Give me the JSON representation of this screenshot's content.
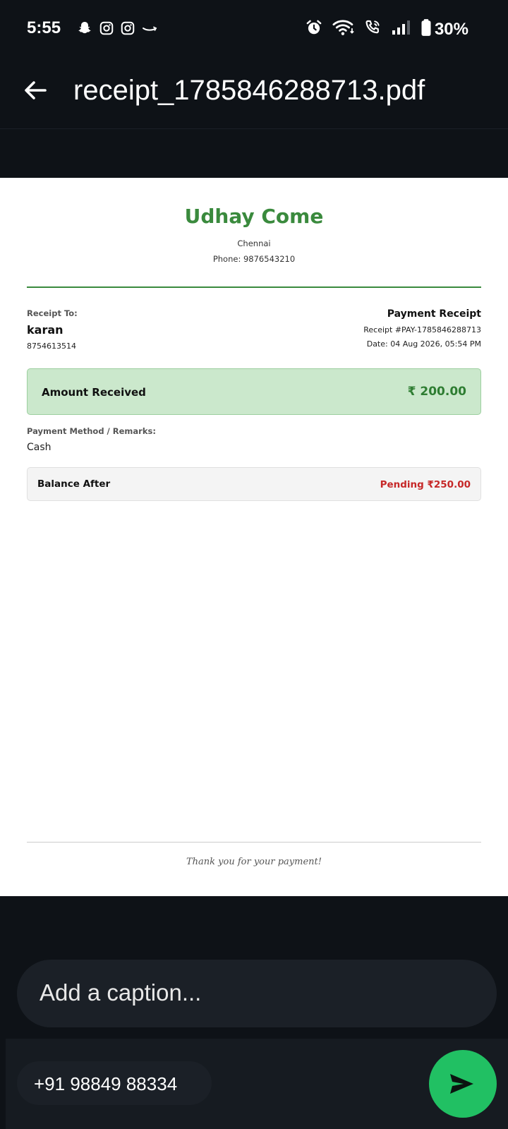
{
  "status_bar": {
    "time": "5:55",
    "battery": "30%",
    "left_icons": [
      "snapchat-icon",
      "instagram-icon",
      "instagram-icon",
      "amazon-icon"
    ],
    "right_icons": [
      "alarm-icon",
      "wifi-icon",
      "wifi-calling-icon",
      "signal-icon",
      "battery-icon"
    ]
  },
  "app_bar": {
    "title": "receipt_1785846288713.pdf"
  },
  "document": {
    "business_name": "Udhay Come",
    "city": "Chennai",
    "phone": "Phone: 9876543210",
    "receipt_to_label": "Receipt To:",
    "customer_name": "karan",
    "customer_phone": "8754613514",
    "receipt_title": "Payment Receipt",
    "receipt_number": "Receipt #PAY-1785846288713",
    "receipt_date": "Date: 04 Aug 2026, 05:54 PM",
    "amount_label": "Amount Received",
    "amount_value": "₹ 200.00",
    "payment_method_label": "Payment Method / Remarks:",
    "payment_method_value": "Cash",
    "balance_label": "Balance After",
    "balance_value": "Pending ₹250.00",
    "thanks": "Thank you for your payment!"
  },
  "caption": {
    "placeholder": "Add a caption..."
  },
  "recipient": {
    "label": "+91 98849 88334"
  },
  "colors": {
    "accent_green": "#3a8a3d",
    "send_button": "#21c063",
    "pending_red": "#c62828",
    "background": "#0e1217"
  }
}
